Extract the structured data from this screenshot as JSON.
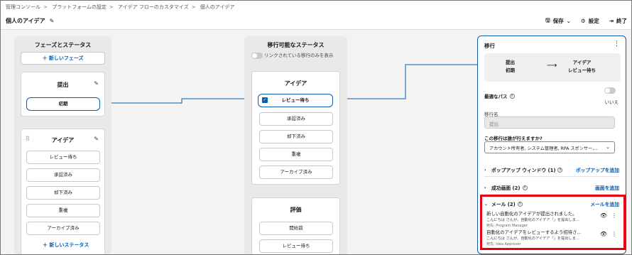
{
  "breadcrumb": [
    "管理コンソール",
    "プラットフォームの設定",
    "アイデア フローのカスタマイズ",
    "個人のアイデア"
  ],
  "page_title": "個人のアイデア",
  "toolbar": {
    "save": "保存",
    "settings": "設定",
    "finish": "終了"
  },
  "phases": {
    "title": "フェーズとステータス",
    "new_phase": "＋ 新しいフェーズ",
    "submit": {
      "title": "提出",
      "statuses": [
        "初期"
      ]
    },
    "idea": {
      "title": "アイデア",
      "statuses": [
        "レビュー待ち",
        "承認済み",
        "却下済み",
        "重複",
        "アーカイブ済み"
      ]
    },
    "new_status": "＋ 新しいステータス"
  },
  "available": {
    "title": "移行可能なステータス",
    "toggle_label": "リンクされている移行のみを表示",
    "idea_group": {
      "title": "アイデア",
      "statuses": [
        "レビュー待ち",
        "承認済み",
        "却下済み",
        "重複",
        "アーカイブ済み"
      ]
    },
    "eval_group": {
      "title": "評価",
      "statuses": [
        "開始前",
        "レビュー待ち"
      ]
    }
  },
  "panel": {
    "title": "移行",
    "from_line1": "提出",
    "from_line2": "初期",
    "arrow": "⟶",
    "to_line1": "アイデア",
    "to_line2": "レビュー待ち",
    "best_path": "最適なパス",
    "toggle_state": "いいえ",
    "name_label": "移行名",
    "name_value": "提出",
    "who_label": "この移行は誰が行えますか?",
    "who_value": "アカウント所有者, システム管理者, RPA スポンサー,...",
    "popup": {
      "label": "ポップアップ ウィンドウ (1)",
      "action": "ポップアップを追加"
    },
    "success": {
      "label": "成功画面 (2)",
      "action": "画面を追加"
    },
    "mail": {
      "label": "メール (2)",
      "action": "メールを追加",
      "items": [
        {
          "subject": "新しい自動化のアイデアが提出されました。",
          "body": "こんにちは さんが、自動化のアイデア「」を提出しま...",
          "to": "宛先: Program Manager"
        },
        {
          "subject": "自動化のアイデアをレビューするよう招待さ...",
          "body": "こんにちは さんが、自動化のアイデア「」を提出しま...",
          "to": "宛先: Idea Approver"
        }
      ]
    }
  }
}
